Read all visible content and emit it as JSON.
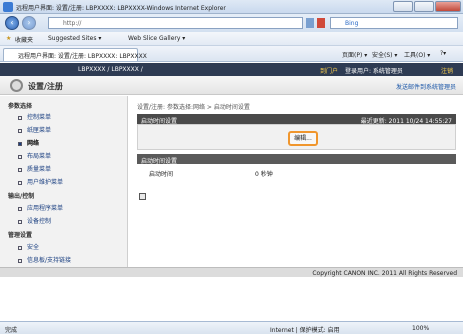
{
  "window": {
    "title": "远程用户界面: 设置/注册: LBPXXXX: LBPXXXX-Windows Internet Explorer"
  },
  "addressbar": {
    "url": "http://",
    "search_placeholder": "Bing"
  },
  "favorites": {
    "favorites_label": "收藏夹",
    "suggested_sites": "Suggested Sites ▾",
    "web_slice": "Web Slice Gallery ▾"
  },
  "tabs": {
    "active_tab": "远程用户界面: 设置/注册: LBPXXXX: LBPXXXX",
    "cmd_page": "页面(P) ▾",
    "cmd_safety": "安全(S) ▾",
    "cmd_tools": "工具(O) ▾",
    "cmd_help": "?▾"
  },
  "header": {
    "device_name": "LBPXXXX / LBPXXXX /",
    "portal": "到门户",
    "login_user": "登录用户: 系统管理员",
    "logout": "注销"
  },
  "page": {
    "title": "设置/注册",
    "notify": "发送邮件到系统管理员"
  },
  "sidebar": {
    "sections": [
      {
        "title": "参数选择",
        "items": [
          "控制菜单",
          "纸匣菜单",
          "网络",
          "布局菜单",
          "质量菜单",
          "用户维护菜单"
        ]
      },
      {
        "title": "输出/控制",
        "items": [
          "应用程序菜单",
          "设备控制"
        ]
      },
      {
        "title": "管理设置",
        "items": [
          "安全",
          "信息板/支持链接"
        ]
      }
    ],
    "active_item": "网络"
  },
  "main": {
    "breadcrumb": "设置/注册: 参数选择:网络 > 启动时间设置",
    "panel_title": "启动时间设置",
    "last_updated": "最近更新: 2011 10/24 14:55:27",
    "edit_button": "编辑...",
    "section_title": "启动时间设置",
    "field_label": "启动时间",
    "field_value": "0 秒钟"
  },
  "footer": {
    "copyright": "Copyright CANON INC. 2011 All Rights Reserved"
  },
  "status": {
    "left": "完成",
    "zone": "Internet | 保护模式: 启用",
    "zoom": "100%"
  },
  "colors": {
    "header_dark": "#2e3b53",
    "accent_orange": "#f0962d",
    "link_blue": "#1a3f80"
  }
}
